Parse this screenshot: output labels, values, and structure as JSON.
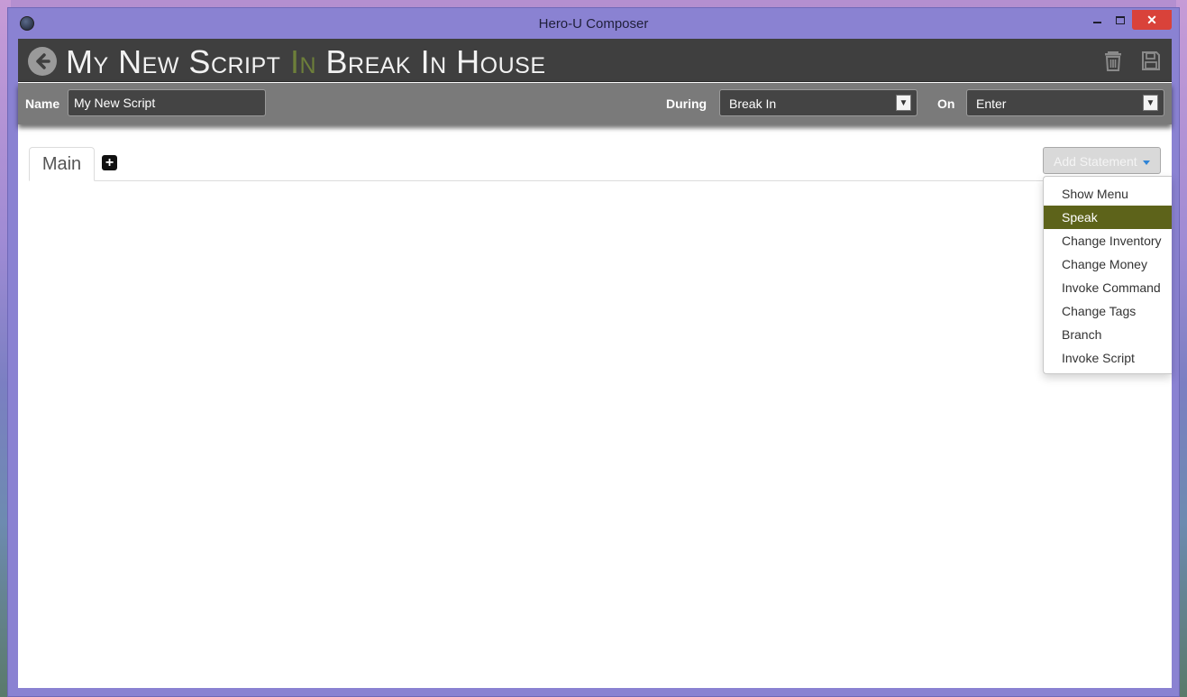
{
  "window": {
    "title": "Hero-U Composer",
    "close_label": "✕"
  },
  "header": {
    "title_part1": "My New Script ",
    "title_in": "In",
    "title_part2": " Break In House",
    "accent_color": "#6d7f3a"
  },
  "props": {
    "name_label": "Name",
    "name_value": "My New Script",
    "during_label": "During",
    "during_value": "Break In",
    "on_label": "On",
    "on_value": "Enter"
  },
  "tabs": {
    "items": [
      {
        "label": "Main",
        "active": true
      }
    ],
    "add_icon": "plus-icon"
  },
  "add_statement": {
    "label": "Add Statement",
    "menu": [
      {
        "label": "Show Menu"
      },
      {
        "label": "Speak",
        "highlighted": true
      },
      {
        "label": "Change Inventory"
      },
      {
        "label": "Change Money"
      },
      {
        "label": "Invoke Command"
      },
      {
        "label": "Change Tags"
      },
      {
        "label": "Branch"
      },
      {
        "label": "Invoke Script"
      }
    ]
  },
  "icons": [
    "back-arrow-icon",
    "trash-icon",
    "save-icon",
    "app-icon"
  ],
  "colors": {
    "header_bg": "#3f3f3f",
    "props_bg": "#7a7a7a",
    "highlight": "#5d631a",
    "close_button": "#d9423a"
  }
}
